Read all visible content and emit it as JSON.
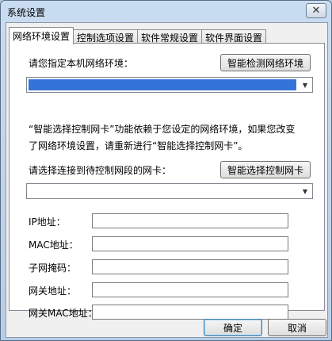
{
  "window": {
    "title": "系统设置",
    "close_glyph": "✕"
  },
  "tabs": [
    {
      "label": "网络环境设置",
      "active": true
    },
    {
      "label": "控制选项设置",
      "active": false
    },
    {
      "label": "软件常规设置",
      "active": false
    },
    {
      "label": "软件界面设置",
      "active": false
    }
  ],
  "network_env": {
    "label": "请您指定本机网络环境：",
    "detect_button": "智能检测网络环境",
    "select_value": ""
  },
  "description": {
    "line1": "“智能选择控制网卡”功能依赖于您设定的网络环境，如果您改变",
    "line2": "了网络环境设置，请重新进行“智能选择控制网卡”。"
  },
  "nic": {
    "label": "请选择连接到待控制网段的网卡：",
    "select_button": "智能选择控制网卡",
    "select_value": ""
  },
  "fields": [
    {
      "label": "IP地址：",
      "value": ""
    },
    {
      "label": "MAC地址：",
      "value": ""
    },
    {
      "label": "子网掩码：",
      "value": ""
    },
    {
      "label": "网关地址：",
      "value": ""
    },
    {
      "label": "网关MAC地址：",
      "value": ""
    }
  ],
  "footer": {
    "ok": "确定",
    "cancel": "取消"
  },
  "icons": {
    "dropdown": "chevron-down-icon",
    "close": "close-icon"
  },
  "colors": {
    "selection": "#3474d8",
    "title_bar": "#b9d1ea"
  }
}
